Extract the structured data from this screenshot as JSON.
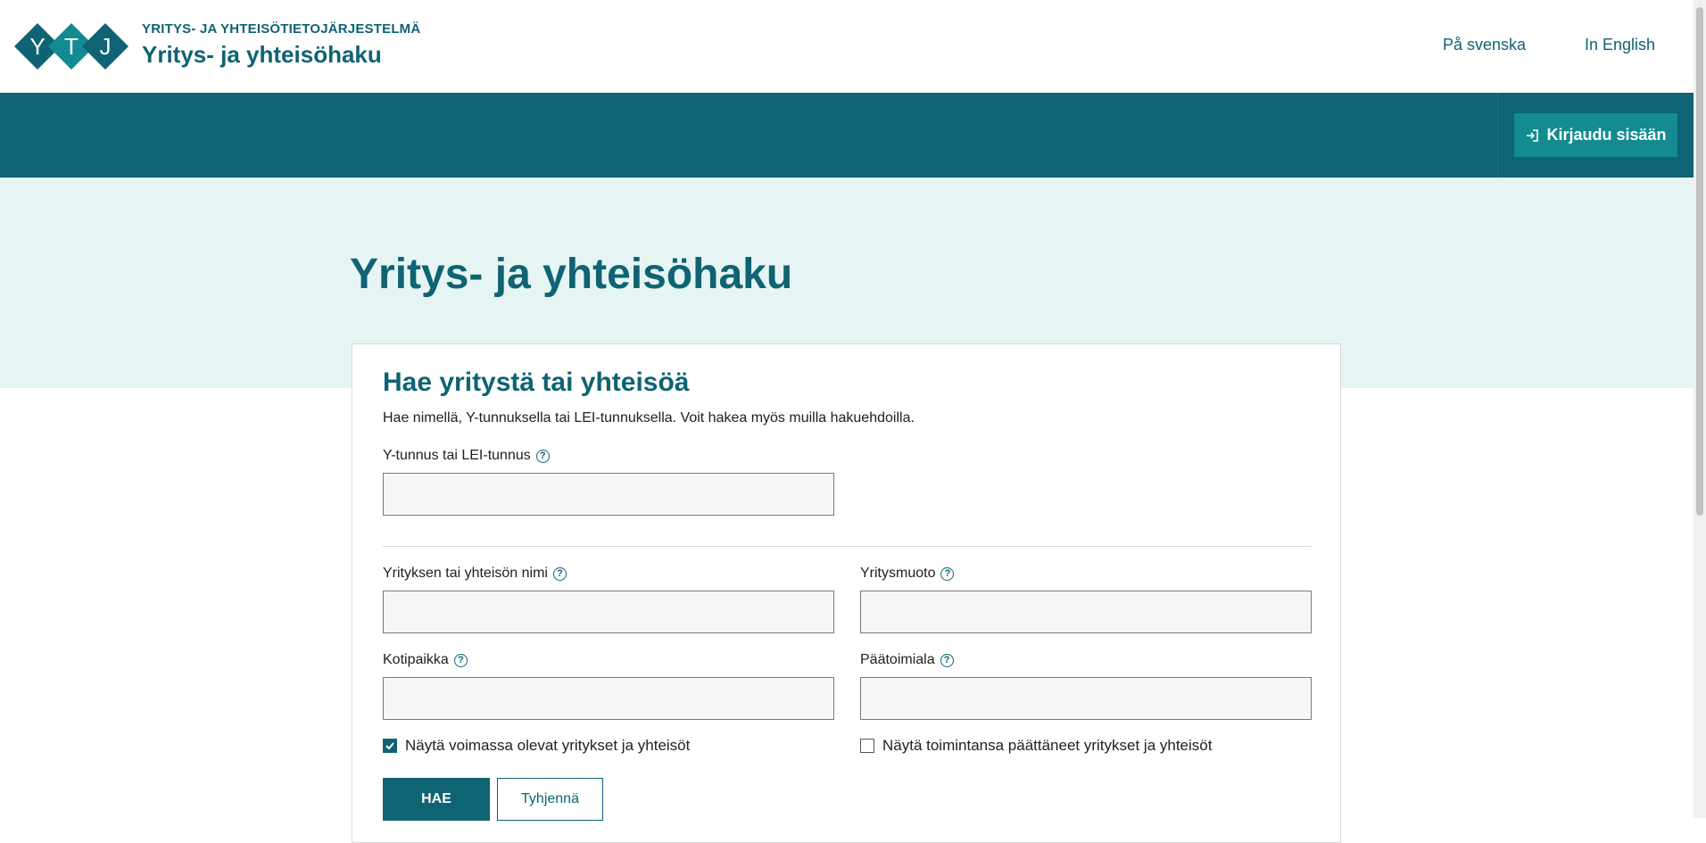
{
  "header": {
    "brand_small": "YRITYS- JA YHTEISÖTIETOJÄRJESTELMÄ",
    "brand_title": "Yritys- ja yhteisöhaku",
    "logo_letters": [
      "Y",
      "T",
      "J"
    ],
    "lang_sv": "På svenska",
    "lang_en": "In English"
  },
  "nav": {
    "login_label": "Kirjaudu sisään",
    "login_icon": "login-icon"
  },
  "hero": {
    "title": "Yritys- ja yhteisöhaku"
  },
  "form": {
    "title": "Hae yritystä tai yhteisöä",
    "description": "Hae nimellä, Y-tunnuksella tai LEI-tunnuksella. Voit hakea myös muilla hakuehdoilla.",
    "help_glyph": "?",
    "fields": {
      "ytunnus": {
        "label": "Y-tunnus tai LEI-tunnus",
        "value": ""
      },
      "name": {
        "label": "Yrityksen tai yhteisön nimi",
        "value": ""
      },
      "form_type": {
        "label": "Yritysmuoto",
        "value": ""
      },
      "home_town": {
        "label": "Kotipaikka",
        "value": ""
      },
      "industry": {
        "label": "Päätoimiala",
        "value": ""
      }
    },
    "checkboxes": {
      "active": {
        "label": "Näytä voimassa olevat yritykset ja yhteisöt",
        "checked": true
      },
      "ceased": {
        "label": "Näytä toimintansa päättäneet yritykset ja yhteisöt",
        "checked": false
      }
    },
    "search_label": "HAE",
    "clear_label": "Tyhjennä"
  },
  "colors": {
    "primary": "#0f6373",
    "accent": "#138b90",
    "hero_bg": "#e6f5f3"
  }
}
